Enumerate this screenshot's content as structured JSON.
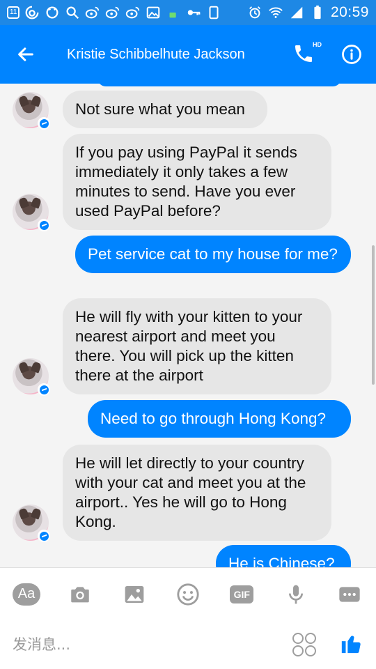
{
  "status_bar": {
    "badge": "11",
    "time": "20:59",
    "left_icons": [
      "weibo-icon",
      "circle-icon",
      "search-icon",
      "weibo-icon",
      "weibo-icon",
      "weibo-icon",
      "image-icon",
      "battery-small-icon",
      "key-icon",
      "phone-outline-icon"
    ],
    "right_icons": [
      "alarm-icon",
      "wifi-icon",
      "signal-icon",
      "battery-icon"
    ]
  },
  "header": {
    "contact_name": "Kristie Schibbelhute Jackson",
    "call_badge": "HD",
    "accent_color": "#0084ff"
  },
  "messages": [
    {
      "direction": "in",
      "text": "Not sure what you mean"
    },
    {
      "direction": "in",
      "text": "If you pay using PayPal it sends immediately it only takes a few minutes to send. Have you ever used PayPal before?"
    },
    {
      "direction": "out",
      "text": "Pet service cat to my house for me?"
    },
    {
      "direction": "in",
      "text": "He will fly with your kitten to your nearest airport and meet you there. You will pick up the kitten there at the airport"
    },
    {
      "direction": "out",
      "text": "Need to go through Hong Kong?"
    },
    {
      "direction": "in",
      "text": "He will let directly to your country with your cat and meet you at the airport.. Yes he will go to Hong Kong."
    },
    {
      "direction": "out",
      "text": "He is Chinese?"
    }
  ],
  "toolbar": {
    "aa_label": "Aa",
    "gif_label": "GIF",
    "icons": [
      "camera-icon",
      "gallery-icon",
      "emoji-icon",
      "gif-icon",
      "microphone-icon",
      "more-icon"
    ]
  },
  "composer": {
    "placeholder": "发消息...",
    "value": ""
  }
}
